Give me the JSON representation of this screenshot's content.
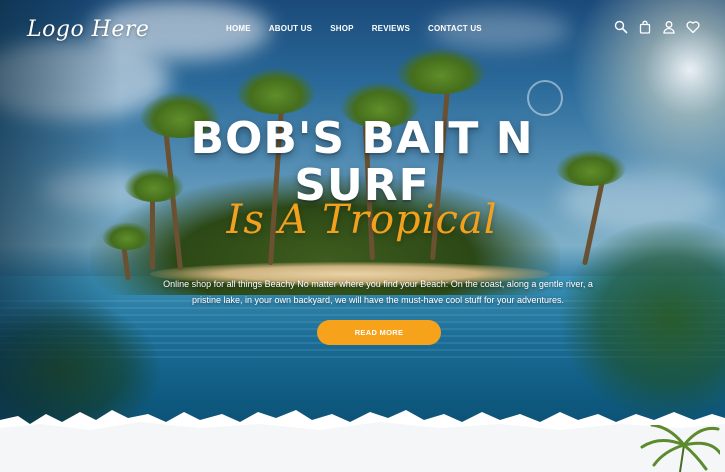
{
  "header": {
    "logo_text": "Logo Here",
    "nav": [
      {
        "label": "HOME"
      },
      {
        "label": "ABOUT US"
      },
      {
        "label": "SHOP"
      },
      {
        "label": "REVIEWS"
      },
      {
        "label": "CONTACT US"
      }
    ],
    "icons": [
      "search-icon",
      "shopping-bag-icon",
      "user-icon",
      "heart-icon"
    ]
  },
  "hero": {
    "title_line1": "BOB'S BAIT N",
    "title_line2": "SURF",
    "subtitle": "Is A Tropical",
    "description_line1": "Online shop for all things Beachy  No matter where you find  your Beach: On the coast, along a gentle river, a",
    "description_line2": "pristine lake, in your own backyard, we will  have the must-have cool stuff for your adventures.",
    "button_label": "READ MORE"
  },
  "colors": {
    "accent": "#f7a21b",
    "subtitle": "#f2a11e",
    "text": "#ffffff"
  }
}
